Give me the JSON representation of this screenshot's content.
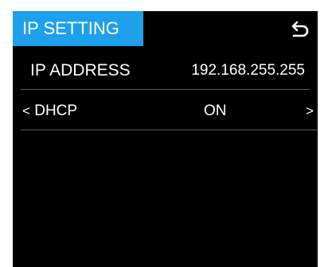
{
  "header": {
    "title": "IP SETTING",
    "back_icon": "back-return-icon"
  },
  "ip_address": {
    "label": "IP ADDRESS",
    "value": "192.168.255.255"
  },
  "dhcp": {
    "prev_arrow": "<",
    "label": "DHCP",
    "value": "ON",
    "next_arrow": ">"
  },
  "colors": {
    "accent": "#1ea0ea",
    "background": "#000000",
    "text": "#ffffff",
    "divider": "#5a5a5a"
  }
}
